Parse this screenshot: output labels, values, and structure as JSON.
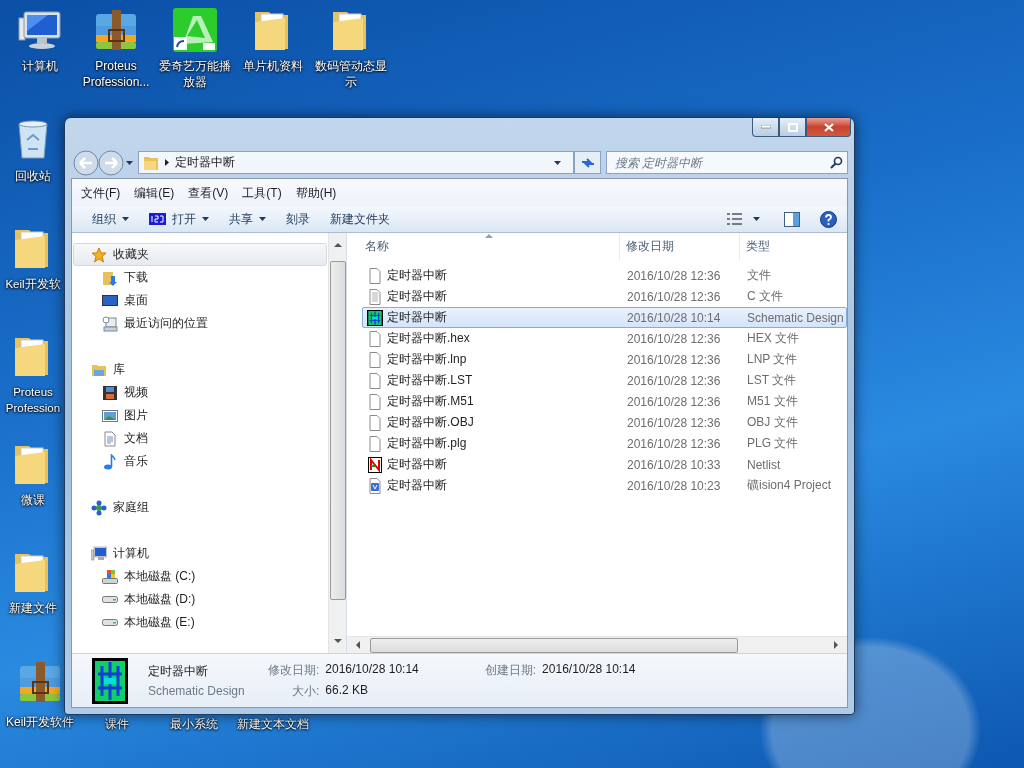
{
  "desktop": {
    "icons": [
      {
        "label": "计算机",
        "kind": "computer"
      },
      {
        "label": "Proteus Profession...",
        "kind": "archive"
      },
      {
        "label": "爱奇艺万能播放器",
        "kind": "app"
      },
      {
        "label": "单片机资料",
        "kind": "folder"
      },
      {
        "label": "数码管动态显示",
        "kind": "folder"
      },
      {
        "label": "回收站",
        "kind": "recycle"
      },
      {
        "label": "Keil开发软",
        "kind": "folder"
      },
      {
        "label": "Proteus Profession",
        "kind": "folder"
      },
      {
        "label": "微课",
        "kind": "folder"
      },
      {
        "label": "新建文件",
        "kind": "folder"
      },
      {
        "label": "Keil开发软件",
        "kind": "archive"
      },
      {
        "label": "课件",
        "kind": "covered"
      },
      {
        "label": "最小系统",
        "kind": "covered"
      },
      {
        "label": "新建文本文档",
        "kind": "covered"
      }
    ]
  },
  "window": {
    "address": {
      "path": "定时器中断"
    },
    "search": {
      "placeholder": "搜索 定时器中断"
    },
    "menu": [
      "文件(F)",
      "编辑(E)",
      "查看(V)",
      "工具(T)",
      "帮助(H)"
    ],
    "commands": [
      {
        "label": "组织",
        "kind": "dropdown"
      },
      {
        "label": "打开",
        "kind": "app-dropdown"
      },
      {
        "label": "共享",
        "kind": "dropdown"
      },
      {
        "label": "刻录",
        "kind": "plain"
      },
      {
        "label": "新建文件夹",
        "kind": "plain"
      }
    ],
    "nav_pane": [
      {
        "label": "收藏夹",
        "kind": "star",
        "selected": true,
        "children": [
          {
            "label": "下载",
            "kind": "download",
            "selected": false
          },
          {
            "label": "桌面",
            "kind": "desktop",
            "selected": false
          },
          {
            "label": "最近访问的位置",
            "kind": "recent",
            "selected": false
          }
        ]
      },
      {
        "label": "库",
        "kind": "library",
        "selected": false,
        "children": [
          {
            "label": "视频",
            "kind": "video",
            "selected": false
          },
          {
            "label": "图片",
            "kind": "image",
            "selected": false
          },
          {
            "label": "文档",
            "kind": "document",
            "selected": false
          },
          {
            "label": "音乐",
            "kind": "music",
            "selected": false
          }
        ]
      },
      {
        "label": "家庭组",
        "kind": "homegroup",
        "selected": false
      },
      {
        "label": "计算机",
        "kind": "computer",
        "selected": false,
        "children": [
          {
            "label": "本地磁盘 (C:)",
            "kind": "system-drive",
            "selected": false
          },
          {
            "label": "本地磁盘 (D:)",
            "kind": "drive",
            "selected": false
          },
          {
            "label": "本地磁盘 (E:)",
            "kind": "drive",
            "selected": false
          }
        ]
      }
    ],
    "file_list": {
      "columns": [
        "名称",
        "修改日期",
        "类型"
      ],
      "rows": [
        {
          "name": "定时器中断",
          "modified": "2016/10/28 12:36",
          "type": "文件",
          "kind": "blank",
          "selected": false
        },
        {
          "name": "定时器中断",
          "modified": "2016/10/28 12:36",
          "type": "C 文件",
          "kind": "text",
          "selected": false
        },
        {
          "name": "定时器中断",
          "modified": "2016/10/28 10:14",
          "type": "Schematic Design",
          "kind": "schematic",
          "selected": true
        },
        {
          "name": "定时器中断.hex",
          "modified": "2016/10/28 12:36",
          "type": "HEX 文件",
          "kind": "blank",
          "selected": false
        },
        {
          "name": "定时器中断.lnp",
          "modified": "2016/10/28 12:36",
          "type": "LNP 文件",
          "kind": "blank",
          "selected": false
        },
        {
          "name": "定时器中断.LST",
          "modified": "2016/10/28 12:36",
          "type": "LST 文件",
          "kind": "blank",
          "selected": false
        },
        {
          "name": "定时器中断.M51",
          "modified": "2016/10/28 12:36",
          "type": "M51 文件",
          "kind": "blank",
          "selected": false
        },
        {
          "name": "定时器中断.OBJ",
          "modified": "2016/10/28 12:36",
          "type": "OBJ 文件",
          "kind": "blank",
          "selected": false
        },
        {
          "name": "定时器中断.plg",
          "modified": "2016/10/28 12:36",
          "type": "PLG 文件",
          "kind": "blank",
          "selected": false
        },
        {
          "name": "定时器中断",
          "modified": "2016/10/28 10:33",
          "type": "Netlist",
          "kind": "netlist",
          "selected": false
        },
        {
          "name": "定时器中断",
          "modified": "2016/10/28 10:23",
          "type": "礦ision4 Project",
          "kind": "project",
          "selected": false
        }
      ]
    },
    "details": {
      "name": "定时器中断",
      "type": "Schematic Design",
      "kind": "schematic",
      "fields": [
        {
          "label": "修改日期:",
          "value": "2016/10/28 10:14"
        },
        {
          "label": "创建日期:",
          "value": "2016/10/28 10:14"
        },
        {
          "label": "大小:",
          "value": "66.2 KB"
        }
      ]
    }
  }
}
